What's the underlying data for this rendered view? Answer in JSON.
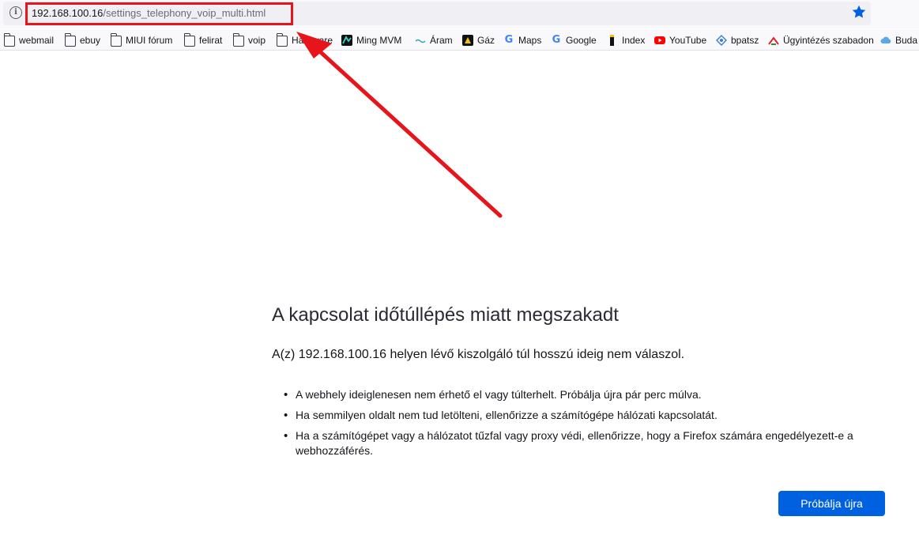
{
  "browser": {
    "url_host": "192.168.100.16",
    "url_path": "/settings_telephony_voip_multi.html",
    "accent_color": "#0061e0",
    "highlight_color": "#e8141b"
  },
  "bookmarks": [
    {
      "label": "webmail",
      "icon": "folder-icon"
    },
    {
      "label": "ebuy",
      "icon": "folder-icon"
    },
    {
      "label": "MIUI fórum",
      "icon": "folder-icon"
    },
    {
      "label": "felirat",
      "icon": "folder-icon"
    },
    {
      "label": "voip",
      "icon": "folder-icon"
    },
    {
      "label": "Hardware",
      "icon": "folder-icon"
    },
    {
      "label": "Ming MVM",
      "icon": "mvm-icon"
    },
    {
      "label": "Áram",
      "icon": "aram-icon"
    },
    {
      "label": "Gáz",
      "icon": "gaz-icon"
    },
    {
      "label": "Maps",
      "icon": "google-icon"
    },
    {
      "label": "Google",
      "icon": "google-icon"
    },
    {
      "label": "Index",
      "icon": "index-icon"
    },
    {
      "label": "YouTube",
      "icon": "youtube-icon"
    },
    {
      "label": "bpatsz",
      "icon": "bpatsz-icon"
    },
    {
      "label": "Ügyintézés szabadon",
      "icon": "ugyintezes-icon"
    },
    {
      "label": "Buda",
      "icon": "cloud-icon"
    }
  ],
  "error": {
    "title": "A kapcsolat időtúllépés miatt megszakadt",
    "description": "A(z) 192.168.100.16 helyen lévő kiszolgáló túl hosszú ideig nem válaszol.",
    "items": [
      "A webhely ideiglenesen nem érhető el vagy túlterhelt. Próbálja újra pár perc múlva.",
      "Ha semmilyen oldalt nem tud letölteni, ellenőrizze a számítógépe hálózati kapcsolatát.",
      "Ha a számítógépet vagy a hálózatot tűzfal vagy proxy védi, ellenőrizze, hogy a Firefox számára engedélyezett-e a webhozzáférés."
    ],
    "retry_label": "Próbálja újra"
  }
}
